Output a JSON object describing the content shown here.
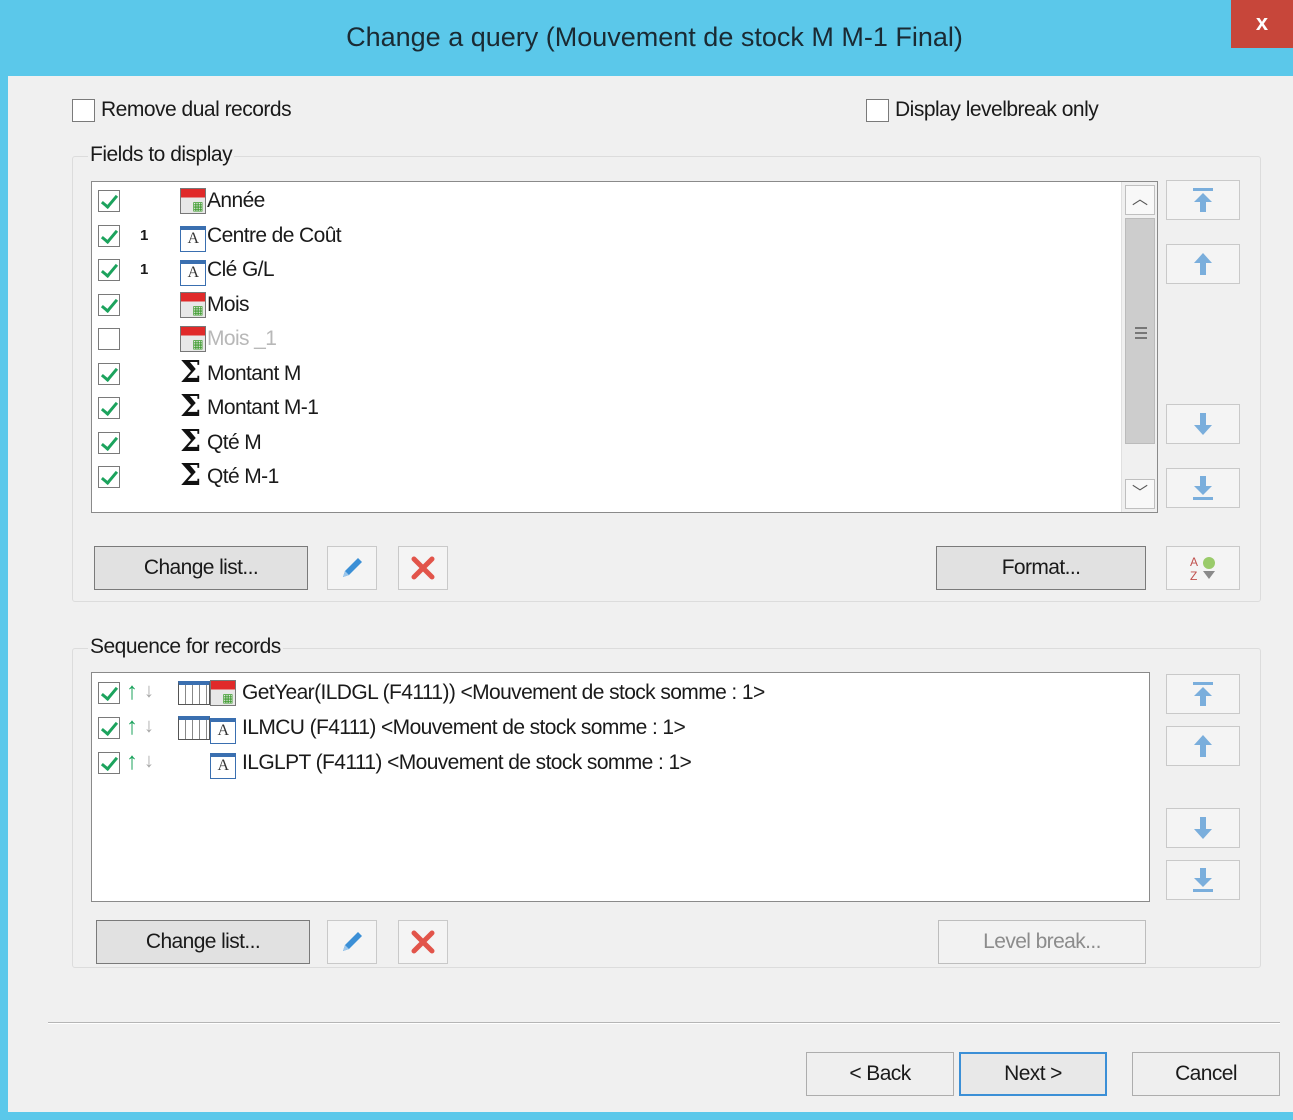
{
  "window": {
    "title": "Change a query (Mouvement de stock M M-1 Final)",
    "close_label": "x"
  },
  "options": {
    "remove_dual_records": {
      "label": "Remove dual records",
      "checked": false
    },
    "display_levelbreak_only": {
      "label": "Display levelbreak only",
      "checked": false
    }
  },
  "fields_group": {
    "label": "Fields to display",
    "items": [
      {
        "label": "Année",
        "checked": true,
        "level": "",
        "icon": "calendar-icon"
      },
      {
        "label": "Centre de Coût",
        "checked": true,
        "level": "1",
        "icon": "text-field-icon"
      },
      {
        "label": "Clé G/L",
        "checked": true,
        "level": "1",
        "icon": "text-field-icon"
      },
      {
        "label": "Mois",
        "checked": true,
        "level": "",
        "icon": "calendar-icon"
      },
      {
        "label": "Mois _1",
        "checked": false,
        "level": "",
        "icon": "calendar-icon",
        "disabled": true
      },
      {
        "label": "Montant M",
        "checked": true,
        "level": "",
        "icon": "sigma-icon"
      },
      {
        "label": "Montant M-1",
        "checked": true,
        "level": "",
        "icon": "sigma-icon"
      },
      {
        "label": "Qté M",
        "checked": true,
        "level": "",
        "icon": "sigma-icon"
      },
      {
        "label": "Qté M-1",
        "checked": true,
        "level": "",
        "icon": "sigma-icon"
      }
    ],
    "change_list_label": "Change list...",
    "format_label": "Format..."
  },
  "sequence_group": {
    "label": "Sequence for records",
    "items": [
      {
        "label": "GetYear(ILDGL (F4111)) <Mouvement de stock somme : 1>",
        "checked": true,
        "levelbreak": true,
        "icon": "calendar-icon"
      },
      {
        "label": "ILMCU (F4111) <Mouvement de stock somme : 1>",
        "checked": true,
        "levelbreak": true,
        "icon": "text-field-icon"
      },
      {
        "label": "ILGLPT (F4111) <Mouvement de stock somme : 1>",
        "checked": true,
        "levelbreak": false,
        "icon": "text-field-icon"
      }
    ],
    "change_list_label": "Change list...",
    "level_break_label": "Level break..."
  },
  "footer": {
    "back_label": "< Back",
    "next_label": "Next >",
    "cancel_label": "Cancel"
  },
  "colors": {
    "titlebar": "#5bc8ea",
    "close": "#c7463a",
    "check": "#1ca35d",
    "accent_blue": "#3b8fd6"
  }
}
